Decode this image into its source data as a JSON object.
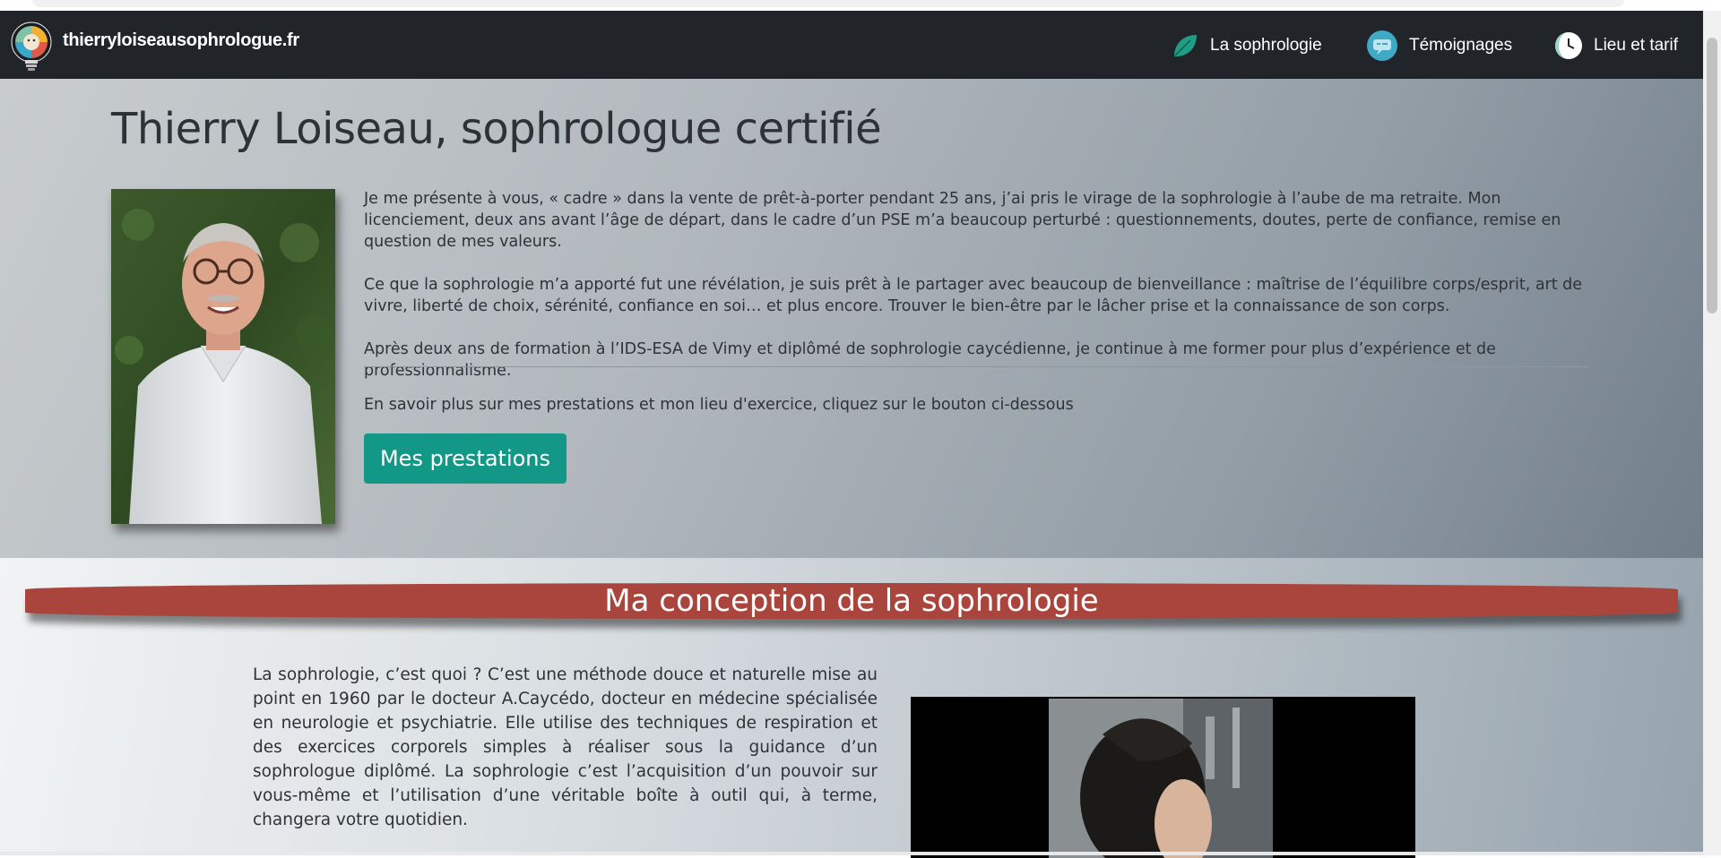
{
  "navbar": {
    "site_name": "thierryloiseausophrologue.fr",
    "logo_icon": "lightbulb-face-logo-icon",
    "items": [
      {
        "label": "La sophrologie",
        "icon": "leaf-icon"
      },
      {
        "label": "Témoignages",
        "icon": "speech-bubble-icon"
      },
      {
        "label": "Lieu et tarif",
        "icon": "moon-clock-icon"
      }
    ]
  },
  "hero": {
    "title": "Thierry Loiseau, sophrologue certifié",
    "paragraphs": [
      "Je me présente à vous, « cadre » dans la vente de prêt-à-porter pendant 25 ans, j’ai pris le virage de la sophrologie à l’aube de ma retraite. Mon licenciement, deux ans avant l’âge de départ, dans le cadre d’un PSE m’a beaucoup perturbé : questionnements, doutes, perte de confiance, remise en question de mes valeurs.",
      "Ce que la sophrologie m’a apporté fut une révélation, je suis prêt à le partager avec beaucoup de bienveillance : maîtrise de l’équilibre corps/esprit, art de vivre, liberté de choix, sérénité, confiance en soi… et plus encore. Trouver le bien-être par le lâcher prise et la connaissance de son corps.",
      "Après deux ans de formation à l’IDS-ESA de Vimy et diplômé de sophrologie caycédienne, je continue à me former pour plus d’expérience et de professionnalisme."
    ],
    "cta_text": "En savoir plus sur mes prestations et mon lieu d'exercice, cliquez sur le bouton ci-dessous",
    "button_label": "Mes prestations"
  },
  "section": {
    "title": "Ma conception de la sophrologie",
    "text": "La sophrologie, c’est quoi ? C’est une méthode douce et naturelle mise au point en 1960 par le docteur A.Caycédo, docteur en médecine spécialisée en neurologie et psychiatrie. Elle utilise des techniques de respiration et des exercices corporels simples à réaliser sous la guidance d’un sophrologue diplômé. La sophrologie c’est l’acquisition d’un pouvoir sur vous-même et l’utilisation d’une véritable boîte à outil qui, à terme, changera votre quotidien."
  },
  "colors": {
    "navbar_bg": "#212529",
    "button_teal": "#139887",
    "ribbon_red": "#a9453d"
  }
}
